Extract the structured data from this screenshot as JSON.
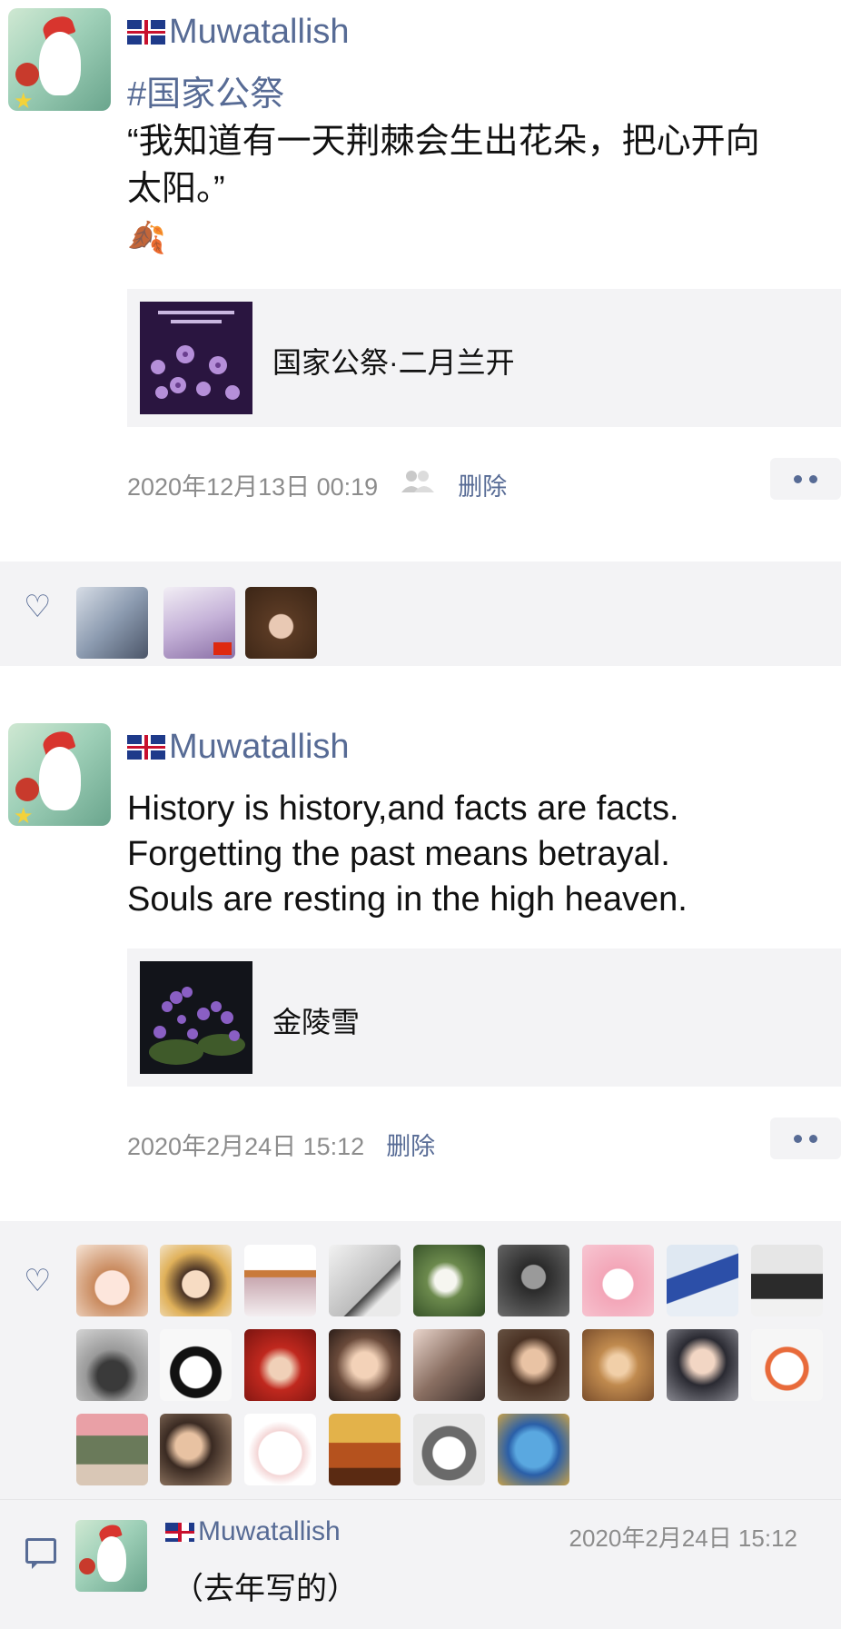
{
  "posts": [
    {
      "author": "Muwatallish",
      "flag_icon": "uk-flag-icon",
      "hashtag": "#国家公祭",
      "text_line1": "“我知道有一天荆棘会生出花朵，把心开向",
      "text_line2": "太阳。”",
      "emoji": "🍂",
      "card_title": "国家公祭·二月兰开",
      "timestamp": "2020年12月13日 00:19",
      "visibility_icon": "friends-icon",
      "delete_label": "删除",
      "likes_count": 3
    },
    {
      "author": "Muwatallish",
      "flag_icon": "uk-flag-icon",
      "text_line1": "History is history,and facts are facts.",
      "text_line2": "Forgetting the past means betrayal.",
      "text_line3": "Souls are resting in the high heaven.",
      "card_title": "金陵雪",
      "timestamp": "2020年2月24日 15:12",
      "delete_label": "删除",
      "likes_count": 24,
      "comment": {
        "author": "Muwatallish",
        "time": "2020年2月24日 15:12",
        "text": "（去年写的）"
      }
    }
  ],
  "colors": {
    "link": "#576b95",
    "meta": "#8c8c8c",
    "panel": "#f3f3f5"
  }
}
